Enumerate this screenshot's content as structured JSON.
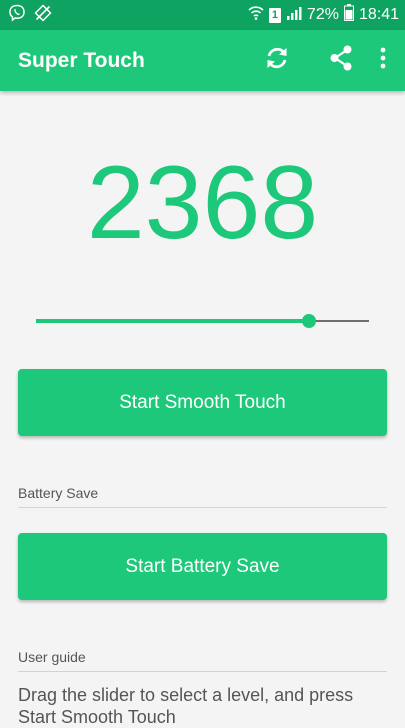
{
  "status_bar": {
    "battery_percent": "72%",
    "time": "18:41",
    "sim_slot": "1",
    "icons": [
      "viber-icon",
      "no-location-icon",
      "wifi-icon",
      "sim-icon",
      "signal-icon",
      "battery-icon"
    ]
  },
  "app_bar": {
    "title": "Super Touch",
    "actions": [
      "refresh-icon",
      "share-icon",
      "more-vertical-icon"
    ]
  },
  "main": {
    "level_value": "2368",
    "slider_fraction": 0.82,
    "smooth_touch_button": "Start Smooth Touch",
    "battery_save_label": "Battery Save",
    "battery_save_button": "Start Battery Save",
    "user_guide_label": "User guide",
    "user_guide_text": "Drag the slider to select a level, and press Start Smooth Touch"
  },
  "colors": {
    "primary": "#1ec87a",
    "status_bar": "#0fa361",
    "background": "#f4f4f4"
  }
}
